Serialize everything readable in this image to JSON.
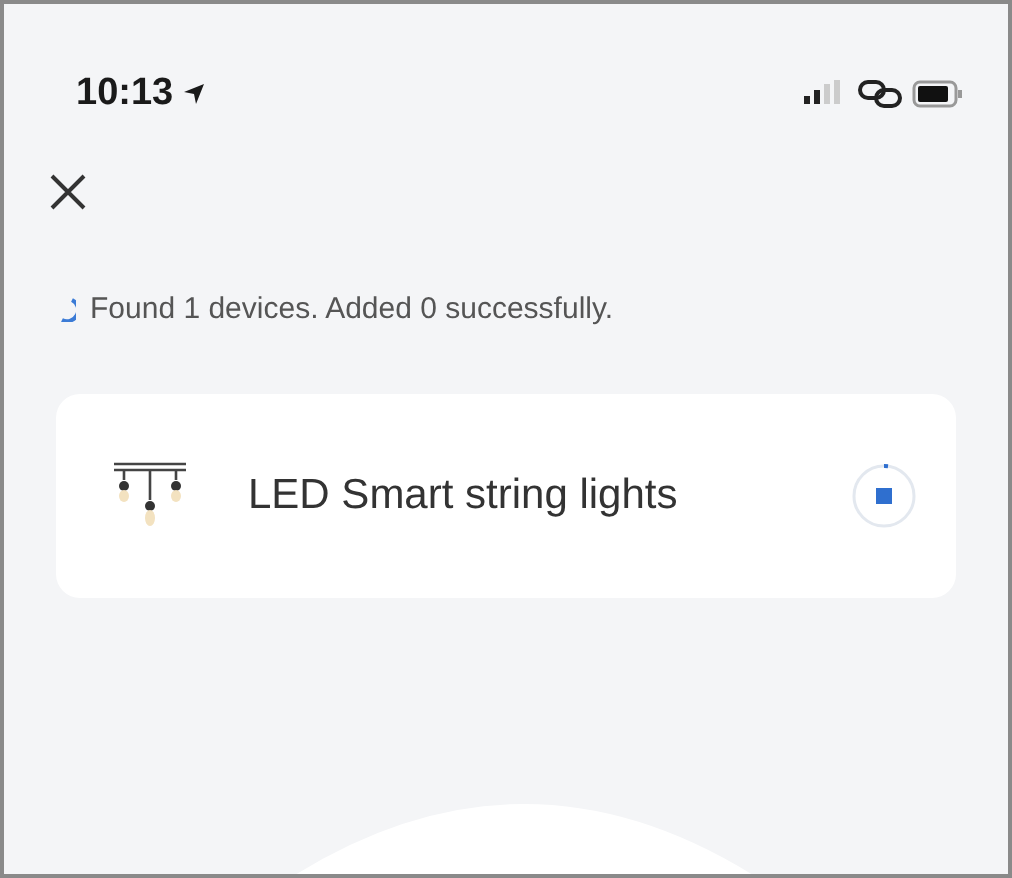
{
  "status_bar": {
    "time": "10:13"
  },
  "progress": {
    "message": "Found 1 devices. Added 0 successfully."
  },
  "devices": [
    {
      "name": "LED Smart string lights"
    }
  ]
}
